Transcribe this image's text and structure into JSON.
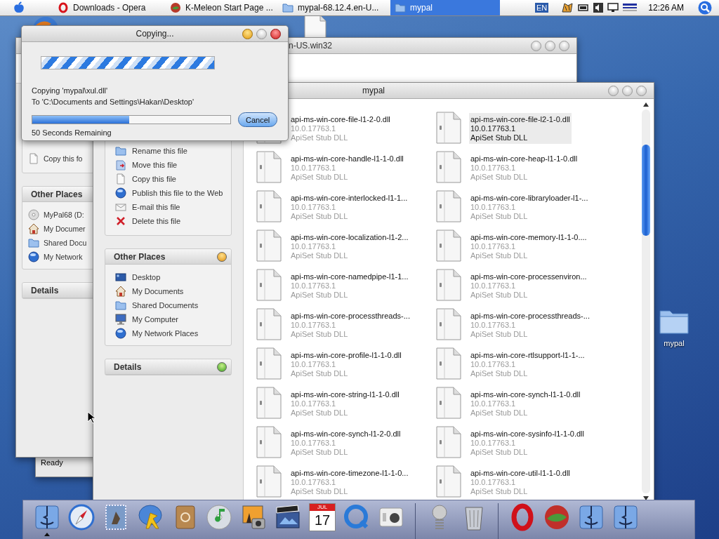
{
  "menubar": {
    "tasks": [
      {
        "label": "Downloads - Opera",
        "kind": "opera",
        "selected": false
      },
      {
        "label": "K-Meleon Start Page ...",
        "kind": "ball",
        "selected": false
      },
      {
        "label": "mypal-68.12.4.en-U...",
        "kind": "folder",
        "selected": false
      },
      {
        "label": "mypal",
        "kind": "folder",
        "selected": true
      }
    ],
    "language": "EN",
    "clock": "12:26 AM"
  },
  "back_window": {
    "title": "n-US.win32",
    "tasks": [
      {
        "label": "Copy this fo",
        "kind": "doc"
      }
    ],
    "other_places": {
      "title": "Other Places",
      "items": [
        {
          "label": "MyPal68 (D:",
          "kind": "disc"
        },
        {
          "label": "My Documer",
          "kind": "house"
        },
        {
          "label": "Shared Docu",
          "kind": "folder"
        },
        {
          "label": "My Network",
          "kind": "globe"
        }
      ]
    },
    "details": {
      "title": "Details"
    }
  },
  "status_window": {
    "status": "Ready"
  },
  "folder_window": {
    "title": "mypal",
    "tasks": [
      {
        "label": "Rename this file",
        "kind": "folder"
      },
      {
        "label": "Move this file",
        "kind": "docarrow"
      },
      {
        "label": "Copy this file",
        "kind": "doc"
      },
      {
        "label": "Publish this file to the Web",
        "kind": "globe"
      },
      {
        "label": "E-mail this file",
        "kind": "envelope"
      },
      {
        "label": "Delete this file",
        "kind": "x"
      }
    ],
    "other_places": {
      "title": "Other Places",
      "items": [
        {
          "label": "Desktop",
          "kind": "desktop"
        },
        {
          "label": "My Documents",
          "kind": "house"
        },
        {
          "label": "Shared Documents",
          "kind": "folder"
        },
        {
          "label": "My Computer",
          "kind": "monitor"
        },
        {
          "label": "My Network Places",
          "kind": "globe"
        }
      ]
    },
    "details": {
      "title": "Details"
    },
    "files": [
      {
        "name": "api-ms-win-core-file-l1-2-0.dll",
        "version": "10.0.17763.1",
        "description": "ApiSet Stub DLL",
        "selected": false
      },
      {
        "name": "api-ms-win-core-file-l2-1-0.dll",
        "version": "10.0.17763.1",
        "description": "ApiSet Stub DLL",
        "selected": true
      },
      {
        "name": "api-ms-win-core-handle-l1-1-0.dll",
        "version": "10.0.17763.1",
        "description": "ApiSet Stub DLL",
        "selected": false
      },
      {
        "name": "api-ms-win-core-heap-l1-1-0.dll",
        "version": "10.0.17763.1",
        "description": "ApiSet Stub DLL",
        "selected": false
      },
      {
        "name": "api-ms-win-core-interlocked-l1-1...",
        "version": "10.0.17763.1",
        "description": "ApiSet Stub DLL",
        "selected": false
      },
      {
        "name": "api-ms-win-core-libraryloader-l1-...",
        "version": "10.0.17763.1",
        "description": "ApiSet Stub DLL",
        "selected": false
      },
      {
        "name": "api-ms-win-core-localization-l1-2...",
        "version": "10.0.17763.1",
        "description": "ApiSet Stub DLL",
        "selected": false
      },
      {
        "name": "api-ms-win-core-memory-l1-1-0....",
        "version": "10.0.17763.1",
        "description": "ApiSet Stub DLL",
        "selected": false
      },
      {
        "name": "api-ms-win-core-namedpipe-l1-1...",
        "version": "10.0.17763.1",
        "description": "ApiSet Stub DLL",
        "selected": false
      },
      {
        "name": "api-ms-win-core-processenviron...",
        "version": "10.0.17763.1",
        "description": "ApiSet Stub DLL",
        "selected": false
      },
      {
        "name": "api-ms-win-core-processthreads-...",
        "version": "10.0.17763.1",
        "description": "ApiSet Stub DLL",
        "selected": false
      },
      {
        "name": "api-ms-win-core-processthreads-...",
        "version": "10.0.17763.1",
        "description": "ApiSet Stub DLL",
        "selected": false
      },
      {
        "name": "api-ms-win-core-profile-l1-1-0.dll",
        "version": "10.0.17763.1",
        "description": "ApiSet Stub DLL",
        "selected": false
      },
      {
        "name": "api-ms-win-core-rtlsupport-l1-1-...",
        "version": "10.0.17763.1",
        "description": "ApiSet Stub DLL",
        "selected": false
      },
      {
        "name": "api-ms-win-core-string-l1-1-0.dll",
        "version": "10.0.17763.1",
        "description": "ApiSet Stub DLL",
        "selected": false
      },
      {
        "name": "api-ms-win-core-synch-l1-1-0.dll",
        "version": "10.0.17763.1",
        "description": "ApiSet Stub DLL",
        "selected": false
      },
      {
        "name": "api-ms-win-core-synch-l1-2-0.dll",
        "version": "10.0.17763.1",
        "description": "ApiSet Stub DLL",
        "selected": false
      },
      {
        "name": "api-ms-win-core-sysinfo-l1-1-0.dll",
        "version": "10.0.17763.1",
        "description": "ApiSet Stub DLL",
        "selected": false
      },
      {
        "name": "api-ms-win-core-timezone-l1-1-0...",
        "version": "10.0.17763.1",
        "description": "ApiSet Stub DLL",
        "selected": false
      },
      {
        "name": "api-ms-win-core-util-l1-1-0.dll",
        "version": "10.0.17763.1",
        "description": "ApiSet Stub DLL",
        "selected": false
      }
    ]
  },
  "copy_dialog": {
    "title": "Copying...",
    "source": "Copying 'mypal\\xul.dll'",
    "destination": "To 'C:\\Documents and Settings\\Hakan\\Desktop'",
    "progress": {
      "level": 0.49
    },
    "remaining": "50 Seconds Remaining",
    "cancel": "Cancel"
  },
  "desktop_icons": [
    {
      "label": "mypal"
    }
  ],
  "dock": {
    "sections": [
      [
        {
          "kind": "finder",
          "running": true
        },
        {
          "kind": "compass",
          "running": false
        },
        {
          "kind": "stamp",
          "running": false
        },
        {
          "kind": "videochat",
          "running": false
        },
        {
          "kind": "book",
          "running": false
        },
        {
          "kind": "music",
          "running": false
        },
        {
          "kind": "photo",
          "running": false
        },
        {
          "kind": "movie",
          "running": false
        },
        {
          "kind": "calendar",
          "month": "JUL",
          "day": "17",
          "running": false
        },
        {
          "kind": "quicktime",
          "running": false
        },
        {
          "kind": "prefs",
          "running": false
        }
      ],
      [
        {
          "kind": "spring",
          "running": false
        },
        {
          "kind": "trash",
          "running": false
        }
      ],
      [
        {
          "kind": "opera",
          "running": false
        },
        {
          "kind": "ball",
          "running": false
        },
        {
          "kind": "finder",
          "running": false
        },
        {
          "kind": "finder",
          "running": false
        }
      ]
    ]
  }
}
